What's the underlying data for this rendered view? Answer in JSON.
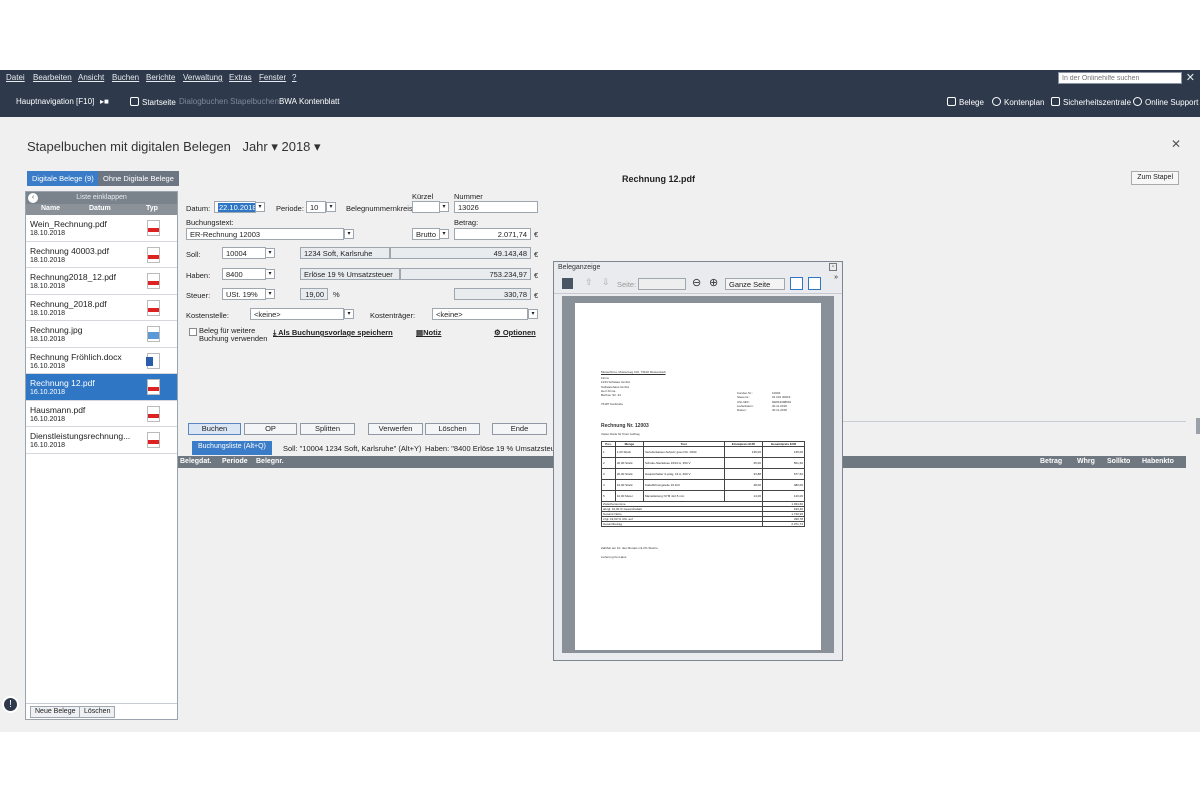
{
  "menu": [
    "Datei",
    "Bearbeiten",
    "Ansicht",
    "Buchen",
    "Berichte",
    "Verwaltung",
    "Extras",
    "Fenster",
    "?"
  ],
  "search": {
    "placeholder": "In der Onlinehilfe suchen"
  },
  "nav": {
    "main": "Hauptnavigation [F10]",
    "startseite": "Startseite",
    "dialogbuchen": "Dialogbuchen",
    "stapelbuchen": "Stapelbuchen",
    "bwa": "BWA",
    "kontenblatt": "Kontenblatt",
    "belege": "Belege",
    "kontenplan": "Kontenplan",
    "sicherheitszentrale": "Sicherheitszentrale",
    "online_support": "Online Support"
  },
  "page": {
    "title": "Stapelbuchen mit digitalen Belegen",
    "jahr_label": "Jahr",
    "jahr_value": "2018"
  },
  "tabs": {
    "digital": "Digitale Belege (9)",
    "ohne": "Ohne Digitale Belege"
  },
  "document_title": "Rechnung 12.pdf",
  "zum_stapel": "Zum Stapel",
  "left": {
    "collapse": "Liste einklappen",
    "col_name": "Name",
    "col_datum": "Datum",
    "col_typ": "Typ",
    "files": [
      {
        "name": "Wein_Rechnung.pdf",
        "date": "18.10.2018",
        "type": "pdf"
      },
      {
        "name": "Rechnung 40003.pdf",
        "date": "18.10.2018",
        "type": "pdf"
      },
      {
        "name": "Rechnung2018_12.pdf",
        "date": "18.10.2018",
        "type": "pdf"
      },
      {
        "name": "Rechnung_2018.pdf",
        "date": "18.10.2018",
        "type": "pdf"
      },
      {
        "name": "Rechnung.jpg",
        "date": "18.10.2018",
        "type": "jpg"
      },
      {
        "name": "Rechnung Fröhlich.docx",
        "date": "16.10.2018",
        "type": "doc"
      },
      {
        "name": "Rechnung 12.pdf",
        "date": "16.10.2018",
        "type": "pdf",
        "selected": true
      },
      {
        "name": "Hausmann.pdf",
        "date": "16.10.2018",
        "type": "pdf"
      },
      {
        "name": "Dienstleistungsrechnung...",
        "date": "16.10.2018",
        "type": "pdf"
      }
    ],
    "new_btn": "Neue Belege",
    "delete_btn": "Löschen"
  },
  "form": {
    "datum_label": "Datum:",
    "datum_value": "22.10.2018",
    "periode_label": "Periode:",
    "periode_value": "10",
    "belegnummernkreis_label": "Belegnummernkreis:",
    "kuerzel_label": "Kürzel",
    "nummer_label": "Nummer",
    "nummer_value": "13026",
    "buchungstext_label": "Buchungstext:",
    "buchungstext_value": "ER-Rechnung 12003",
    "brutto_value": "Brutto",
    "betrag_label": "Betrag:",
    "betrag_value": "2.071,74",
    "currency": "€",
    "soll_label": "Soll:",
    "soll_value": "10004",
    "soll_desc": "1234 Soft, Karlsruhe",
    "soll_amount": "49.143,48",
    "haben_label": "Haben:",
    "haben_value": "8400",
    "haben_desc": "Erlöse 19 % Umsatzsteuer",
    "haben_amount": "753.234,97",
    "steuer_label": "Steuer:",
    "steuer_value": "USt. 19%",
    "steuer_pct": "19,00",
    "pct": "%",
    "steuer_amount": "330,78",
    "kostenstelle_label": "Kostenstelle:",
    "kostenstelle_value": "<keine>",
    "kostentraeger_label": "Kostenträger:",
    "kostentraeger_value": "<keine>",
    "beleg_weitere_1": "Beleg für weitere",
    "beleg_weitere_2": "Buchung verwenden",
    "als_vorlage": "Als Buchungsvorlage speichern",
    "notiz": "Notiz",
    "optionen": "Optionen"
  },
  "actions": [
    "Buchen",
    "OP",
    "Splitten",
    "Verwerfen",
    "Löschen",
    "Ende"
  ],
  "booklist": {
    "tab": "Buchungsliste (Alt+Q)",
    "soll_info": "Soll: \"10004 1234 Soft, Karlsruhe\" (Alt+Y)",
    "haben_info": "Haben: \"8400 Erlöse 19 % Umsatzsteuer\" (",
    "cols": [
      "Belegdat.",
      "Periode",
      "Belegnr.",
      "Betrag",
      "Whrg",
      "Sollkto",
      "Habenkto"
    ]
  },
  "viewer": {
    "title": "Beleganzeige",
    "seite_label": "Seite:",
    "zoom_value": "Ganze Seite"
  },
  "invoice": {
    "sender_line": "Musterfirma, Musterweg 100, 79100 Musterstadt",
    "addr": [
      "Firma",
      "1234 Software GmbH",
      "Softwarehaus GmbH",
      "Herr Firma",
      "Berliner Str. 34",
      "",
      "76187 Karlsruhe"
    ],
    "meta_labels": [
      "Kunden Nr.:",
      "Steuernr.:",
      "USt-IdNr.:",
      "Lieferdatum:",
      "Datum:"
    ],
    "meta_values": [
      "10004",
      "01 001 00019",
      "DE813398691",
      "30.11.2018",
      "30.11.2018"
    ],
    "title": "Rechnung Nr. 12003",
    "intro": "Vielen Dank für Ihren Auftrag.",
    "head": [
      "Pos.",
      "Menge",
      "Text",
      "Einzelpreis EUR",
      "Gesamtpreis EUR"
    ],
    "rows": [
      [
        "1",
        "1,00 Stück",
        "Verteilerkasten Aufputz grau IVA. F600",
        "135,00",
        "135,00"
      ],
      [
        "2",
        "20,00 Stück",
        "Schuko-Steckdose 16/10 A, 250 V",
        "25,00",
        "501,60"
      ],
      [
        "3",
        "20,00 Stück",
        "Hauptschalter 3-polig, 16 A, 400 V",
        "33,88",
        "677,60"
      ],
      [
        "4",
        "10,00 Stück",
        "Kabelführungsteile 19 Zoll",
        "48,00",
        "480,00"
      ],
      [
        "5",
        "10,00 Meter",
        "Mantelleitung NYM 4x2,5 mm",
        "14,00",
        "140,00"
      ]
    ],
    "zwischensumme_label": "Zwischensumme",
    "zwischensumme": "1.934,60",
    "abzug_label": "abzgl. 10,00 % Gesamtrabatt",
    "abzug": "193,46",
    "netto_label": "Gesamt Netto",
    "netto": "1.740,96",
    "ust_label": "zzgl. 19,00 % USt. auf",
    "ust_base": "1.740,96",
    "ust": "330,78",
    "gesamt_label": "Gesamtbetrag",
    "gesamt": "2.071,74",
    "footer1": "Zahlbar am 10. des Monats mit 2% Skonto.",
    "footer2": "Lieferung frei Haus"
  }
}
